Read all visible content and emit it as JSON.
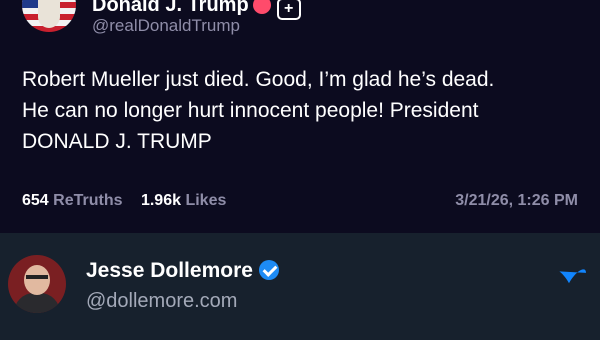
{
  "post": {
    "display_name": "Donald J. Trump",
    "plus_label": "+",
    "handle": "@realDonaldTrump",
    "body_lines": [
      "Robert Mueller just died. Good, I’m glad he’s dead.",
      "He can no longer hurt innocent people! President",
      "DONALD J. TRUMP"
    ],
    "retruths_count": "654",
    "retruths_label": "ReTruths",
    "likes_count": "1.96k",
    "likes_label": "Likes",
    "timestamp": "3/21/26, 1:26 PM"
  },
  "bluesky": {
    "display_name": "Jesse Dollemore",
    "handle": "@dollemore.com",
    "logo": "bluesky-butterfly-icon"
  },
  "colors": {
    "post_bg": "#0c0b1f",
    "bsky_bg": "#17212d",
    "muted": "#8f8da8",
    "verified": "#1d8bf5",
    "bluesky_blue": "#1185fe"
  }
}
